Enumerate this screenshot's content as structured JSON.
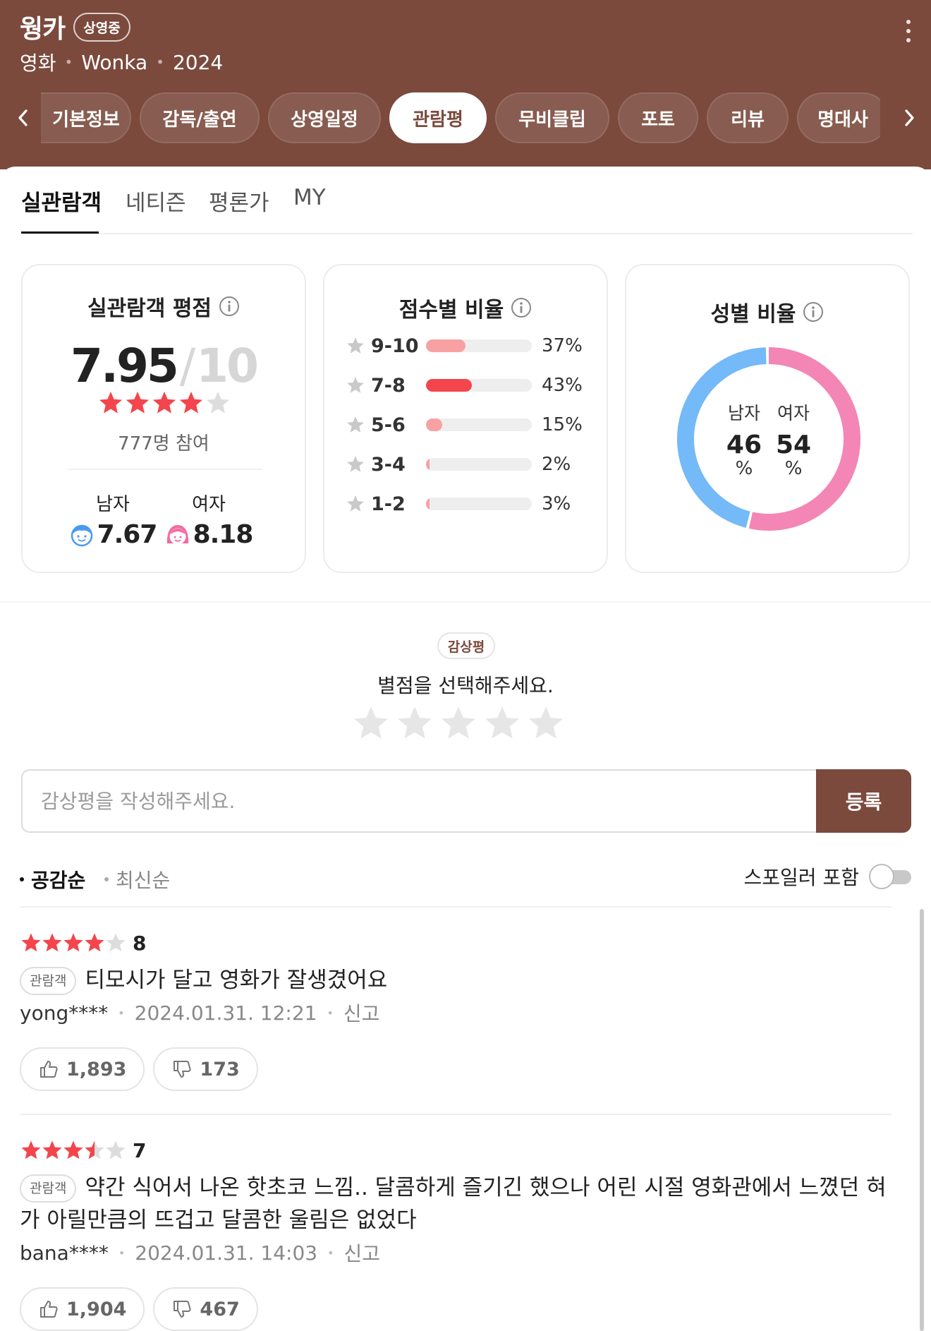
{
  "header": {
    "title": "웡카",
    "status_badge": "상영중",
    "category": "영화",
    "original_title": "Wonka",
    "year": "2024"
  },
  "nav_tabs": [
    "기본정보",
    "감독/출연",
    "상영일정",
    "관람평",
    "무비클립",
    "포토",
    "리뷰",
    "명대사"
  ],
  "active_nav_tab": "관람평",
  "sub_tabs": [
    "실관람객",
    "네티즌",
    "평론가",
    "MY"
  ],
  "active_sub_tab": "실관람객",
  "rating_card": {
    "title": "실관람객 평점",
    "score": "7.95",
    "max": "10",
    "star_fill": 0.795,
    "participants": "777명 참여",
    "male_label": "남자",
    "male_score": "7.67",
    "female_label": "여자",
    "female_score": "8.18"
  },
  "distribution_card": {
    "title": "점수별 비율",
    "rows": [
      {
        "range": "9-10",
        "percent": "37%",
        "value": 37,
        "color": "#f7a1a3"
      },
      {
        "range": "7-8",
        "percent": "43%",
        "value": 43,
        "color": "#f4454c"
      },
      {
        "range": "5-6",
        "percent": "15%",
        "value": 15,
        "color": "#f7a1a3"
      },
      {
        "range": "3-4",
        "percent": "2%",
        "value": 2,
        "color": "#f7a1a3"
      },
      {
        "range": "1-2",
        "percent": "3%",
        "value": 3,
        "color": "#f7a1a3"
      }
    ]
  },
  "gender_card": {
    "title": "성별 비율",
    "male_label": "남자",
    "female_label": "여자",
    "male_value": "46",
    "female_value": "54",
    "unit": "%",
    "male_color": "#74b9f8",
    "female_color": "#f386b4"
  },
  "write_review": {
    "badge": "감상평",
    "prompt": "별점을 선택해주세요.",
    "placeholder": "감상평을 작성해주세요.",
    "submit_label": "등록"
  },
  "sort": {
    "options": [
      "공감순",
      "최신순"
    ],
    "active": "공감순",
    "spoiler_label": "스포일러 포함",
    "spoiler_on": false
  },
  "reviews": [
    {
      "rating": "8",
      "rating_value": 8,
      "badge": "관람객",
      "text": "티모시가 달고 영화가 잘생겼어요",
      "user": "yong****",
      "date": "2024.01.31. 12:21",
      "report": "신고",
      "likes": "1,893",
      "dislikes": "173"
    },
    {
      "rating": "7",
      "rating_value": 7,
      "badge": "관람객",
      "text": "약간 식어서 나온 핫초코 느낌.. 달콤하게 즐기긴 했으나 어린 시절 영화관에서 느꼈던 혀가 아릴만큼의 뜨겁고 달콤한 울림은 없었다",
      "user": "bana****",
      "date": "2024.01.31. 14:03",
      "report": "신고",
      "likes": "1,904",
      "dislikes": "467"
    }
  ],
  "colors": {
    "brand": "#7b4a3d",
    "star_red": "#f4454c",
    "star_gray": "#dddddd"
  }
}
